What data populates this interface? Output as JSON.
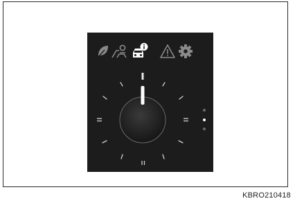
{
  "figure": {
    "caption": "KBRO210418"
  },
  "display": {
    "icons": [
      {
        "name": "eco-leaf-icon",
        "state": "inactive"
      },
      {
        "name": "driver-assist-icon",
        "state": "inactive"
      },
      {
        "name": "vehicle-info-icon",
        "state": "active"
      },
      {
        "name": "warning-icon",
        "state": "inactive"
      },
      {
        "name": "settings-gear-icon",
        "state": "inactive"
      }
    ],
    "page_indicator": {
      "pages": 3,
      "current": 2
    },
    "colors": {
      "screen_bg": "#1c1c1c",
      "active": "#ffffff",
      "inactive": "#7a7a7a"
    }
  }
}
